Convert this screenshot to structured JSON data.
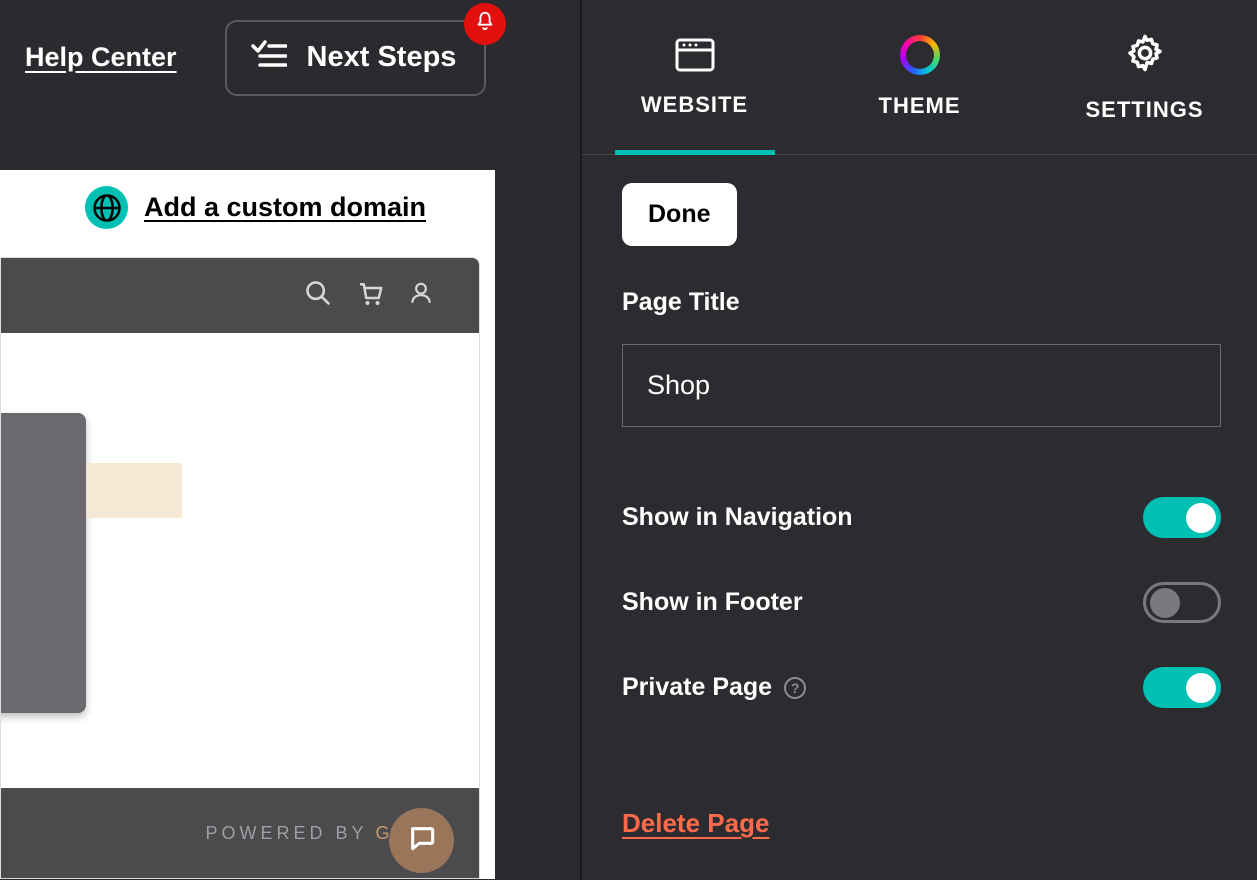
{
  "topbar": {
    "help_center": "Help Center",
    "next_steps": "Next Steps"
  },
  "domain_bar": {
    "link": "Add a custom domain"
  },
  "preview_footer": {
    "powered_by": "POWERED BY",
    "brand_partial": "GODA"
  },
  "tabs": {
    "website": "WEBSITE",
    "theme": "THEME",
    "settings": "SETTINGS"
  },
  "panel": {
    "done": "Done",
    "page_title_label": "Page Title",
    "page_title_value": "Shop",
    "show_nav_label": "Show in Navigation",
    "show_footer_label": "Show in Footer",
    "private_label": "Private Page",
    "delete": "Delete Page",
    "toggles": {
      "show_nav": true,
      "show_footer": false,
      "private": true
    }
  }
}
